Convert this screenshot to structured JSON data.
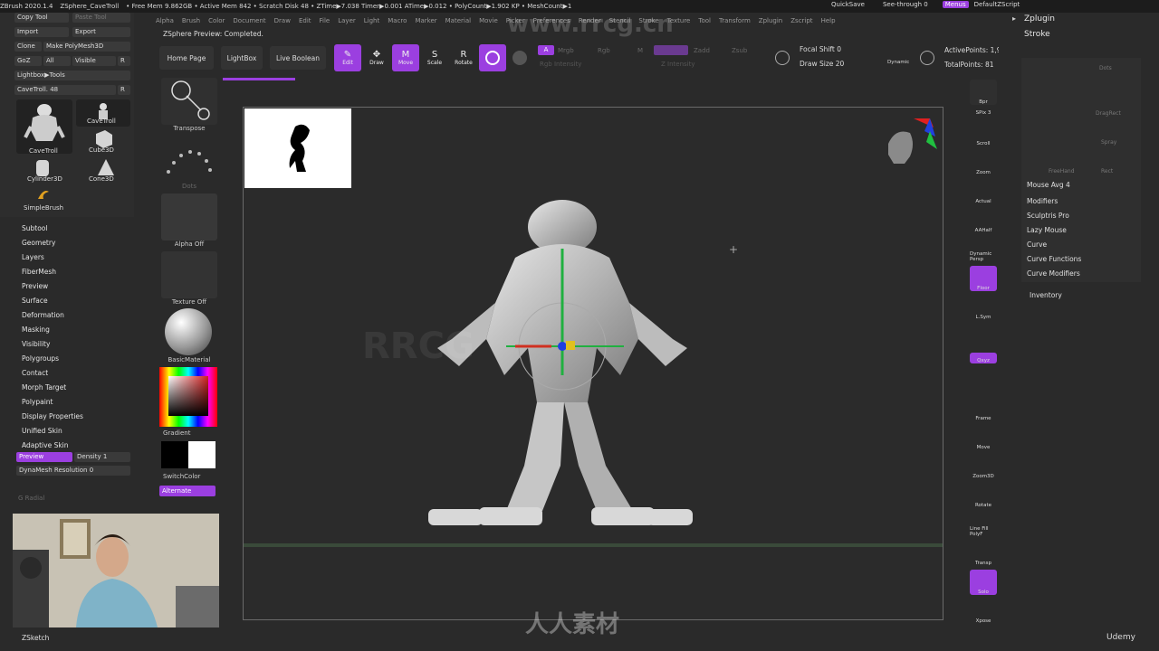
{
  "titlebar": {
    "app": "ZBrush 2020.1.4",
    "doc": "ZSphere_CaveTroll",
    "stats": "• Free Mem 9.862GB • Active Mem 842 • Scratch Disk 48 • ZTime▶7.038 Timer▶0.001 ATime▶0.012 • PolyCount▶1.902 KP • MeshCount▶1",
    "quicksave": "QuickSave",
    "seethrough": "See-through  0",
    "menus": "Menus",
    "zscript": "DefaultZScript"
  },
  "menubar": [
    "Alpha",
    "Brush",
    "Color",
    "Document",
    "Draw",
    "Edit",
    "File",
    "Layer",
    "Light",
    "Macro",
    "Marker",
    "Material",
    "Movie",
    "Picker",
    "Preferences",
    "Render",
    "Stencil",
    "Stroke",
    "Texture",
    "Tool",
    "Transform",
    "Zplugin",
    "Zscript",
    "Help"
  ],
  "status": "ZSphere Preview: Completed.",
  "lefttool": {
    "copy_tool": "Copy Tool",
    "paste_tool": "Paste Tool",
    "import": "Import",
    "export": "Export",
    "clone": "Clone",
    "make_polymesh": "Make PolyMesh3D",
    "goz": "GoZ",
    "all": "All",
    "visible": "Visible",
    "r": "R",
    "lightbox_tools": "Lightbox▶Tools",
    "cavetroll_slider": "CaveTroll. 48",
    "thumbs": [
      "CaveTroll",
      "CaveTroll",
      "Cube3D",
      "Cylinder3D",
      "Cone3D",
      "SimpleBrush"
    ]
  },
  "leftmenu": {
    "items": [
      "Subtool",
      "Geometry",
      "Layers",
      "FiberMesh",
      "Preview",
      "Surface",
      "Deformation",
      "Masking",
      "Visibility",
      "Polygroups",
      "Contact",
      "Morph Target",
      "Polypaint",
      "Display Properties",
      "Unified Skin",
      "Adaptive Skin"
    ],
    "preview_btn": "Preview",
    "density": "Density 1",
    "dynamesh_res": "DynaMesh Resolution 0",
    "g_radial": "G Radial",
    "zsketch": "ZSketch"
  },
  "shelf": {
    "home_page": "Home Page",
    "lightbox": "LightBox",
    "live_boolean": "Live Boolean",
    "tools": [
      {
        "label": "Edit",
        "active": true
      },
      {
        "label": "Draw",
        "active": false
      },
      {
        "label": "Move",
        "active": true
      },
      {
        "label": "Scale",
        "active": false
      },
      {
        "label": "Rotate",
        "active": false
      }
    ],
    "a_label": "A",
    "mrgb": "Mrgb",
    "rgb": "Rgb",
    "m": "M",
    "zadd": "Zadd",
    "zsub": "Zsub",
    "rgb_intensity": "Rgb Intensity",
    "z_intensity": "Z Intensity",
    "focal_shift": "Focal Shift 0",
    "draw_size": "Draw Size 20",
    "dynamic": "Dynamic",
    "active_points": "ActivePoints: 1,9",
    "total_points": "TotalPoints: 81"
  },
  "leftcol": {
    "transpose": "Transpose",
    "dots": "Dots",
    "alpha_off": "Alpha Off",
    "texture_off": "Texture Off",
    "basic_material": "BasicMaterial",
    "gradient": "Gradient",
    "switch_color": "SwitchColor",
    "alternate": "Alternate"
  },
  "rightstrip": [
    "Bpr",
    "SPix 3",
    "Scroll",
    "Zoom",
    "Actual",
    "AAHalf",
    "Dynamic Persp",
    "Floor",
    "L.Sym",
    "Qxyz",
    "Frame",
    "Move",
    "Zoom3D",
    "Rotate",
    "Line Fill PolyF",
    "Transp",
    "Solo",
    "Xpose"
  ],
  "rightpanel": {
    "zplugin": "Zplugin",
    "stroke": "Stroke",
    "dots": "Dots",
    "dragrect": "DragRect",
    "spray": "Spray",
    "freehand": "FreeHand",
    "rect": "Rect",
    "mouse_avg": "Mouse Avg 4",
    "items": [
      "Modifiers",
      "Sculptris Pro",
      "Lazy Mouse",
      "Curve",
      "Curve Functions",
      "Curve Modifiers"
    ],
    "inventory": "Inventory"
  },
  "watermarks": {
    "site": "www.rrcg.cn",
    "brand": "RRCG",
    "cn": "人人素材",
    "udemy": "Udemy"
  },
  "colors": {
    "accent": "#9b3fe0",
    "bg": "#2a2a2a"
  }
}
